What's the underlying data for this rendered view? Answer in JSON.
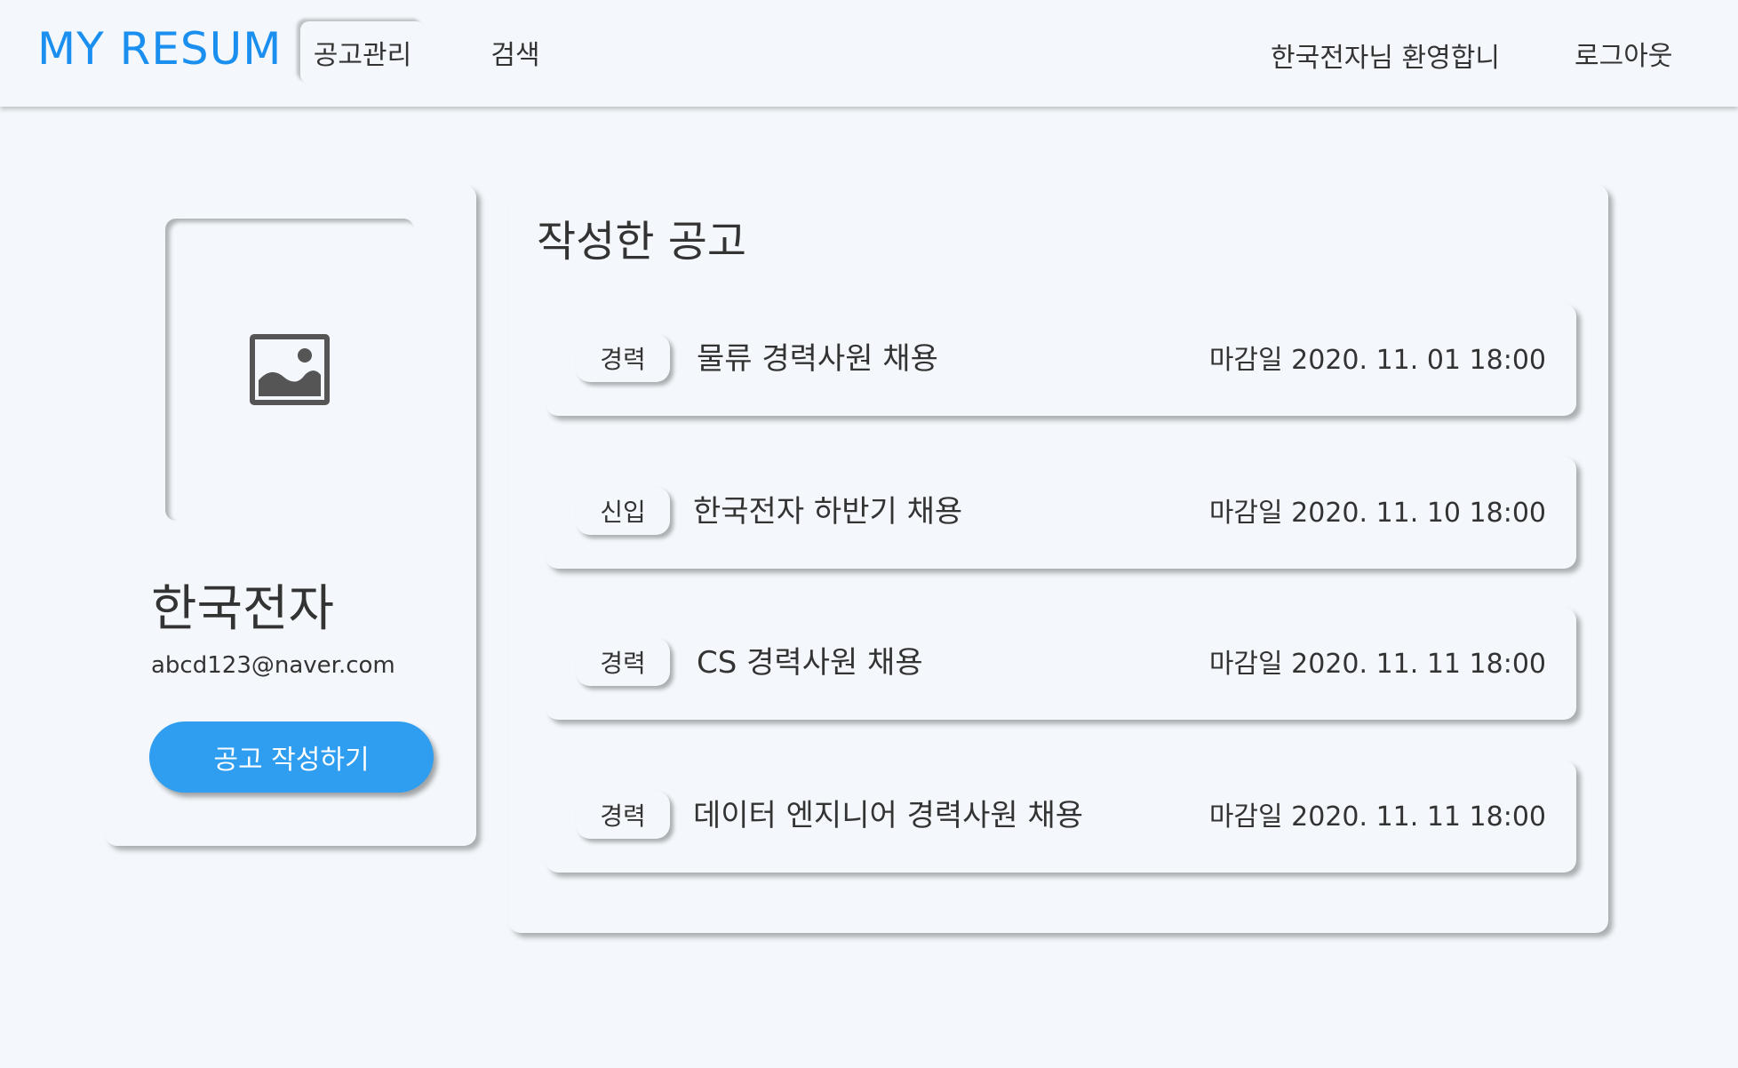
{
  "header": {
    "logo": "MY RESUM",
    "tabs": [
      {
        "label": "공고관리",
        "active": true
      },
      {
        "label": "검색",
        "active": false
      }
    ],
    "welcome": "한국전자님 환영합니",
    "logout": "로그아웃"
  },
  "profile": {
    "image_icon": "image-placeholder-icon",
    "company_name": "한국전자",
    "email": "abcd123@naver.com",
    "create_button": "공고 작성하기"
  },
  "postings": {
    "title": "작성한 공고",
    "items": [
      {
        "badge": "경력",
        "title": "물류 경력사원 채용",
        "deadline": "마감일 2020. 11. 01  18:00"
      },
      {
        "badge": "신입",
        "title": "한국전자 하반기 채용",
        "deadline": "마감일 2020. 11. 10  18:00"
      },
      {
        "badge": "경력",
        "title": "CS 경력사원 채용",
        "deadline": "마감일 2020. 11. 11  18:00"
      },
      {
        "badge": "경력",
        "title": "데이터 엔지니어 경력사원 채용",
        "deadline": "마감일 2020. 11. 11  18:00"
      }
    ]
  },
  "colors": {
    "background": "#f4f8fc",
    "accent": "#1a8ff0",
    "button": "#2f9df0",
    "text": "#333333"
  }
}
